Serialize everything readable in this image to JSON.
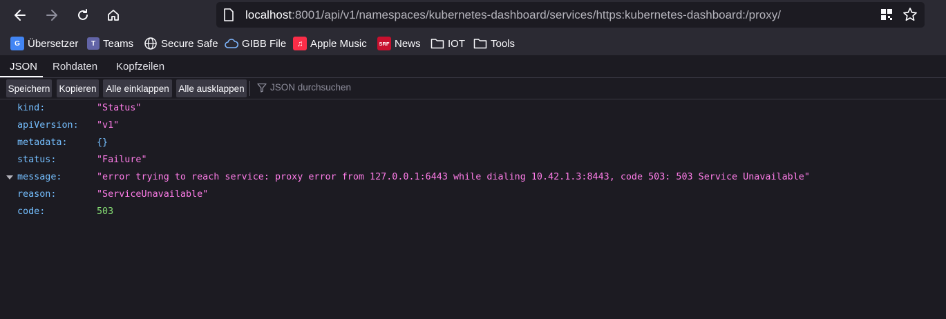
{
  "nav": {
    "url_host": "localhost",
    "url_rest": ":8001/api/v1/namespaces/kubernetes-dashboard/services/https:kubernetes-dashboard:/proxy/",
    "icons": [
      "back-icon",
      "forward-icon",
      "reload-icon",
      "home-icon",
      "page-icon",
      "qr-icon",
      "star-icon"
    ]
  },
  "bookmarks": [
    {
      "label": "Übersetzer",
      "icon": "translate-icon",
      "color": "#4285f4"
    },
    {
      "label": "Teams",
      "icon": "teams-icon",
      "color": "#6264a7"
    },
    {
      "label": "Secure Safe",
      "icon": "globe-icon",
      "color": "#fbfbfe"
    },
    {
      "label": "GIBB File",
      "icon": "cloud-icon",
      "color": "#7fb7ff"
    },
    {
      "label": "Apple Music",
      "icon": "music-icon",
      "color": "#fa2d48"
    },
    {
      "label": "News",
      "icon": "srf-icon",
      "color": "#c8102e",
      "badge": "SRF"
    },
    {
      "label": "IOT",
      "icon": "folder-icon",
      "color": "#fbfbfe"
    },
    {
      "label": "Tools",
      "icon": "folder-icon",
      "color": "#fbfbfe"
    }
  ],
  "viewer_tabs": [
    "JSON",
    "Rohdaten",
    "Kopfzeilen"
  ],
  "toolbar": {
    "buttons": [
      "Speichern",
      "Kopieren",
      "Alle einklappen",
      "Alle ausklappen"
    ],
    "filter_placeholder": "JSON durchsuchen"
  },
  "json_rows": [
    {
      "key": "kind:",
      "value": "\"Status\"",
      "type": "str"
    },
    {
      "key": "apiVersion:",
      "value": "\"v1\"",
      "type": "str"
    },
    {
      "key": "metadata:",
      "value": "{}",
      "type": "obj"
    },
    {
      "key": "status:",
      "value": "\"Failure\"",
      "type": "str"
    },
    {
      "key": "message:",
      "value": "\"error trying to reach service: proxy error from 127.0.0.1:6443 while dialing 10.42.1.3:8443, code 503: 503 Service Unavailable\"",
      "type": "str",
      "expanded": true
    },
    {
      "key": "reason:",
      "value": "\"ServiceUnavailable\"",
      "type": "str"
    },
    {
      "key": "code:",
      "value": "503",
      "type": "num"
    }
  ],
  "colors": {
    "background": "#1c1b22",
    "chrome": "#2b2a33",
    "key": "#75bfff",
    "string": "#ff7de9",
    "number": "#86de74"
  }
}
